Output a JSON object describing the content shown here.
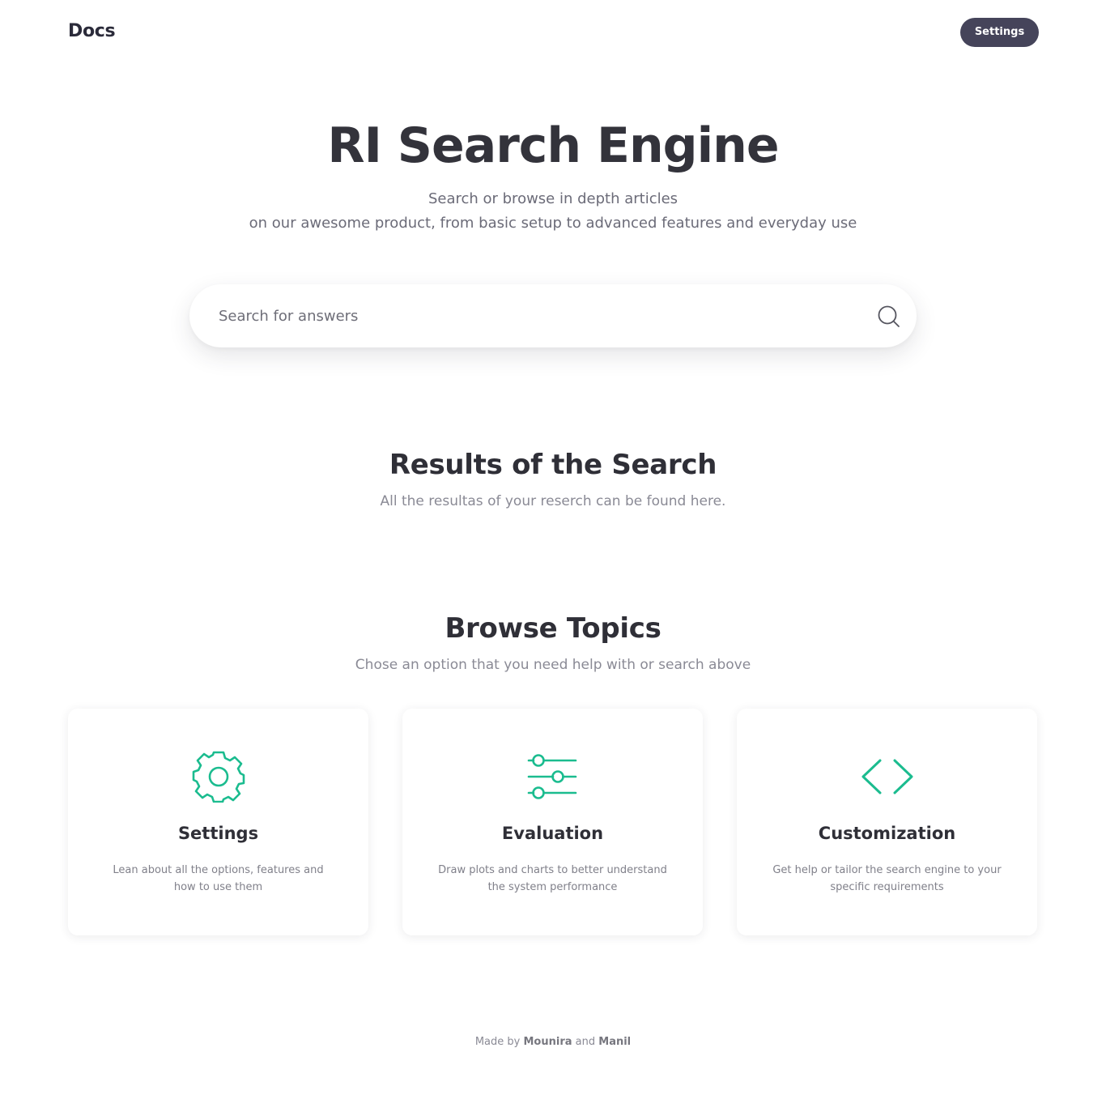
{
  "header": {
    "brand": "Docs",
    "settings_label": "Settings"
  },
  "hero": {
    "title": "RI Search Engine",
    "subtitle_line1": "Search or browse in depth articles",
    "subtitle_line2": "on our awesome product, from basic setup to advanced features and everyday use"
  },
  "search": {
    "placeholder": "Search for answers",
    "value": "",
    "icon": "search-icon"
  },
  "results": {
    "title": "Results of the Search",
    "subtitle": "All the resultas of your reserch can be found here."
  },
  "topics": {
    "title": "Browse Topics",
    "subtitle": "Chose an option that you need help with or search above",
    "cards": [
      {
        "title": "Settings",
        "description": "Lean about all the options, features and how to use them",
        "icon": "gear-icon"
      },
      {
        "title": "Evaluation",
        "description": "Draw plots and charts to better understand the system performance",
        "icon": "sliders-icon"
      },
      {
        "title": "Customization",
        "description": "Get help or tailor the search engine to your specific requirements",
        "icon": "code-icon"
      }
    ]
  },
  "footer": {
    "prefix": "Made by",
    "author1": "Mounira",
    "conjunction": "and",
    "author2": "Manil"
  },
  "colors": {
    "accent": "#1bbc8f",
    "button_bg": "#45445a",
    "heading": "#2f2f37",
    "muted": "#8a8a95"
  }
}
